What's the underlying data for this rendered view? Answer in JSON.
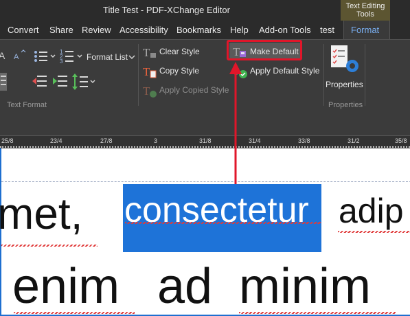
{
  "window": {
    "title": "Title Test - PDF-XChange Editor"
  },
  "context_tab": {
    "label": "Text Editing Tools"
  },
  "menu": {
    "items": [
      "Convert",
      "Share",
      "Review",
      "Accessibility",
      "Bookmarks",
      "Help",
      "Add-on Tools",
      "test"
    ],
    "active": "Format"
  },
  "ribbon": {
    "format_list": "Format List",
    "clear_style": "Clear Style",
    "copy_style": "Copy Style",
    "apply_copied_style": "Apply Copied Style",
    "make_default": "Make Default",
    "apply_default_style": "Apply Default Style",
    "properties": "Properties",
    "group_text_format": "Text Format",
    "group_properties": "Properties"
  },
  "ruler": {
    "ticks": [
      "25/8",
      "23/4",
      "27/8",
      "3",
      "31/8",
      "31/4",
      "33/8",
      "31/2",
      "35/8"
    ]
  },
  "document": {
    "line1": [
      "met,",
      "consectetur",
      "adip"
    ],
    "line2": [
      "enim",
      "ad",
      "minim"
    ]
  },
  "colors": {
    "highlight": "#e0162a",
    "selection": "#1e73d8",
    "active_tab_text": "#79aef0"
  }
}
